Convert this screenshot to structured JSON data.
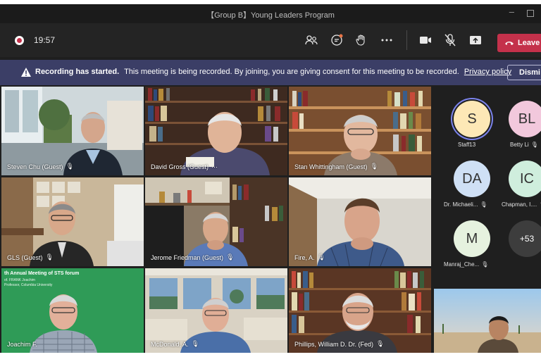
{
  "window": {
    "title": "【Group B】Young Leaders Program"
  },
  "toolbar": {
    "timer": "19:57",
    "leave_label": "Leave",
    "icons": [
      "participants-icon",
      "chat-icon",
      "raise-hand-icon",
      "more-options-icon",
      "camera-icon",
      "mic-muted-icon",
      "share-icon"
    ]
  },
  "banner": {
    "title": "Recording has started.",
    "message": "This meeting is being recorded. By joining, you are giving consent for this meeting to be recorded.",
    "link": "Privacy policy",
    "dismiss": "Dismi"
  },
  "tiles": [
    {
      "name": "Steven Chu (Guest)",
      "mic": "muted"
    },
    {
      "name": "David Gross (Guest)",
      "extra": "···"
    },
    {
      "name": "Stan Whittingham (Guest)",
      "mic": "muted"
    },
    {
      "name": "GLS (Guest)",
      "mic": "muted"
    },
    {
      "name": "Jerome Friedman (Guest)",
      "mic": "muted"
    },
    {
      "name": "Fire, A.",
      "mic": "muted"
    },
    {
      "name": "Joachim F.",
      "mic": "none",
      "bg_text": [
        "th Annual Meeting of STS forum",
        "of. FRANK Joachim",
        "Professor, Columbia University"
      ]
    },
    {
      "name": "McDonald, A.",
      "mic": "muted"
    },
    {
      "name": "Phillips, William D. Dr. (Fed)",
      "mic": "muted"
    }
  ],
  "roster": [
    {
      "initials": "S",
      "name": "Staff13",
      "color": "#fde8b6",
      "ring": true
    },
    {
      "initials": "BL",
      "name": "Betty Li",
      "color": "#f2c8dc"
    },
    {
      "initials": "DA",
      "name": "Dr. Michaeli...",
      "color": "#cfe0f5"
    },
    {
      "initials": "IC",
      "name": "Chapman, I....",
      "color": "#cfeedd"
    },
    {
      "initials": "M",
      "name": "Manraj_Che...",
      "color": "#e6f2df"
    }
  ],
  "roster_more": "+53"
}
